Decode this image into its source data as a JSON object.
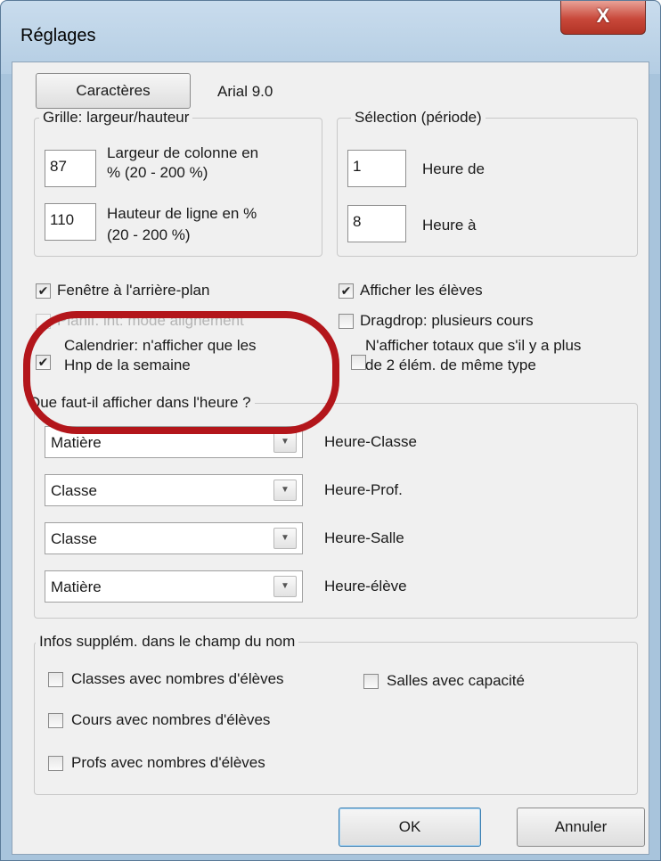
{
  "window": {
    "title": "Réglages",
    "close_label": "X"
  },
  "fonts": {
    "button_label": "Caractères",
    "current_font": "Arial 9.0"
  },
  "grid": {
    "legend": "Grille: largeur/hauteur",
    "width_value": "87",
    "width_label_1": "Largeur de colonne en",
    "width_label_2": "% (20 - 200 %)",
    "height_value": "110",
    "height_label_1": "Hauteur de ligne en %",
    "height_label_2": "(20 - 200 %)"
  },
  "selection": {
    "legend": "Sélection (période)",
    "from_value": "1",
    "from_label": "Heure de",
    "to_value": "8",
    "to_label": "Heure à"
  },
  "options": {
    "background_window": {
      "label": "Fenêtre à l'arrière-plan",
      "checked": true
    },
    "show_students": {
      "label": "Afficher les élèves",
      "checked": true
    },
    "planif_alignment": {
      "label": "Planif. int: mode alignement",
      "checked": false,
      "disabled": true
    },
    "dragdrop": {
      "label": "Dragdrop: plusieurs cours",
      "checked": false
    },
    "calendar": {
      "label_1": "Calendrier: n'afficher que les",
      "label_2": "Hnp de la semaine",
      "checked": true
    },
    "totals": {
      "label_1": "N'afficher totaux que s'il y a plus",
      "label_2": "de 2 élém. de même type",
      "checked": false
    }
  },
  "display_hour": {
    "legend": "Que faut-il afficher dans l'heure ?",
    "rows": [
      {
        "value": "Matière",
        "label": "Heure-Classe"
      },
      {
        "value": "Classe",
        "label": "Heure-Prof."
      },
      {
        "value": "Classe",
        "label": "Heure-Salle"
      },
      {
        "value": "Matière",
        "label": "Heure-élève"
      }
    ]
  },
  "extra_info": {
    "legend": "Infos supplém. dans le champ du nom",
    "classes": {
      "label": "Classes avec nombres d'élèves",
      "checked": false
    },
    "rooms": {
      "label": "Salles avec capacité",
      "checked": false
    },
    "courses": {
      "label": "Cours avec nombres d'élèves",
      "checked": false
    },
    "teachers": {
      "label": "Profs avec nombres d'élèves",
      "checked": false
    }
  },
  "footer": {
    "ok_label": "OK",
    "cancel_label": "Annuler"
  },
  "colors": {
    "highlight": "#b3161b",
    "window_frame": "#a8c4dc",
    "close_button": "#c8483a"
  },
  "icons": {
    "check": "check-icon",
    "dropdown": "chevron-down-icon",
    "close": "close-icon"
  }
}
